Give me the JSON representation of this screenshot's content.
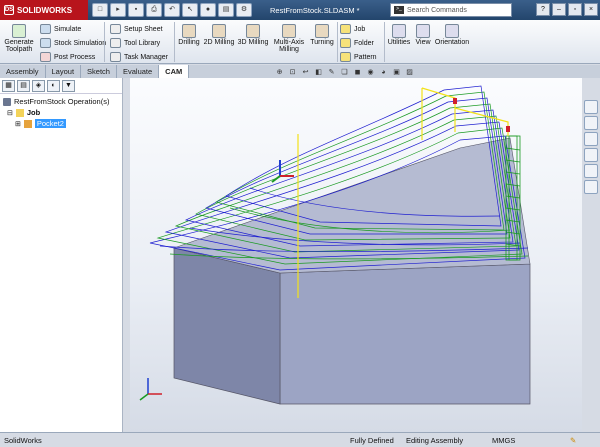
{
  "app": {
    "name": "SOLIDWORKS",
    "document_title": "RestFromStock.SLDASM *"
  },
  "search": {
    "placeholder": "Search Commands"
  },
  "ribbon": {
    "generate": "Generate Toolpath",
    "simulate": "Simulate",
    "stock_simulation": "Stock Simulation",
    "post_process": "Post Process",
    "setup_sheet": "Setup Sheet",
    "tool_library": "Tool Library",
    "task_manager": "Task Manager",
    "drilling": "Drilling",
    "milling_2d": "2D Milling",
    "milling_3d": "3D Milling",
    "multi_axis": "Multi-Axis Milling",
    "turning": "Turning",
    "job": "Job",
    "folder": "Folder",
    "pattern": "Pattern",
    "utilities": "Utilities",
    "view": "View",
    "orientation": "Orientation"
  },
  "tabs": [
    "Assembly",
    "Layout",
    "Sketch",
    "Evaluate",
    "CAM"
  ],
  "tree": {
    "root": "RestFromStock Operation(s)",
    "job": "Job",
    "pocket": "Pocket2"
  },
  "status": {
    "app": "SolidWorks",
    "defined": "Fully Defined",
    "mode": "Editing Assembly",
    "units": "MMGS"
  },
  "colors": {
    "toolpath": "#1f1fd0",
    "toolpath_alt": "#1a9a22",
    "stock": "#8e96b4",
    "brand": "#b8141c"
  }
}
